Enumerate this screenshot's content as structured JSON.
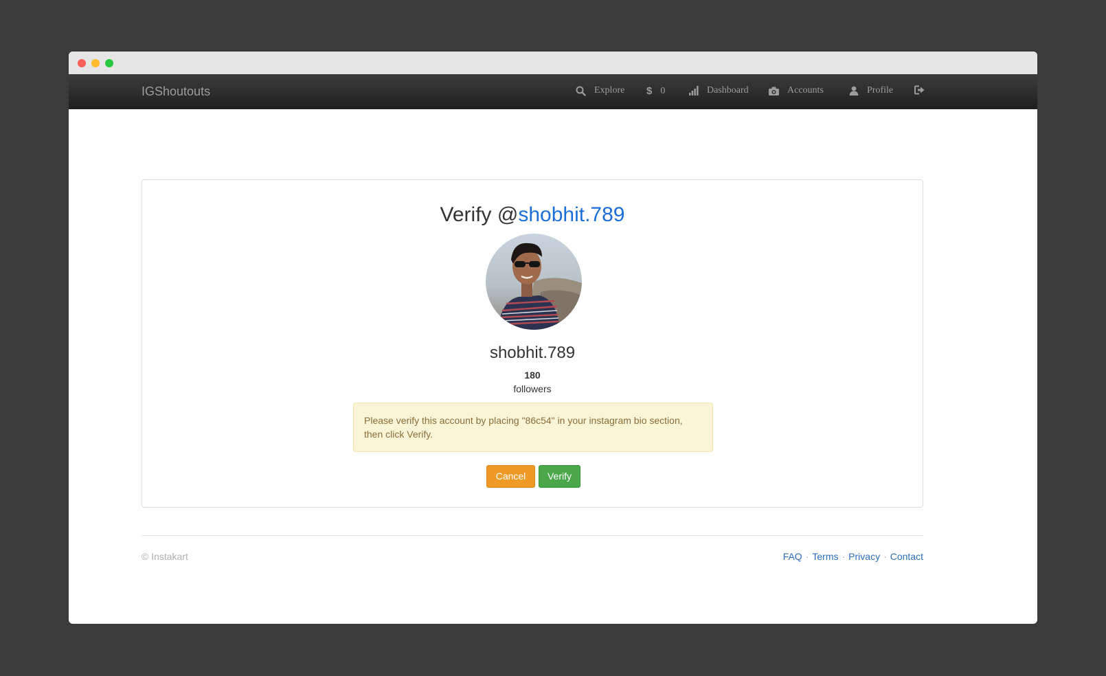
{
  "navbar": {
    "brand": "IGShoutouts",
    "items": [
      {
        "label": "Explore",
        "icon": "search-icon"
      },
      {
        "label": "0",
        "icon": "dollar-icon"
      },
      {
        "label": "Dashboard",
        "icon": "signal-bars-icon"
      },
      {
        "label": "Accounts",
        "icon": "camera-icon"
      },
      {
        "label": "Profile",
        "icon": "user-icon"
      },
      {
        "label": "",
        "icon": "logout-icon"
      }
    ]
  },
  "verify": {
    "title_prefix": "Verify @",
    "title_handle": "shobhit.789",
    "username": "shobhit.789",
    "followers_count": "180",
    "followers_label": "followers",
    "alert_text": "Please verify this account by placing \"86c54\" in your instagram bio section, then click Verify.",
    "cancel_label": "Cancel",
    "verify_label": "Verify"
  },
  "footer": {
    "copyright": "© Instakart",
    "links": [
      "FAQ",
      "Terms",
      "Privacy",
      "Contact"
    ]
  },
  "colors": {
    "handle_link": "#1a6fd8",
    "cancel_button": "#ef9a27",
    "verify_button": "#4aa84a",
    "alert_background": "#fbf5d8"
  }
}
